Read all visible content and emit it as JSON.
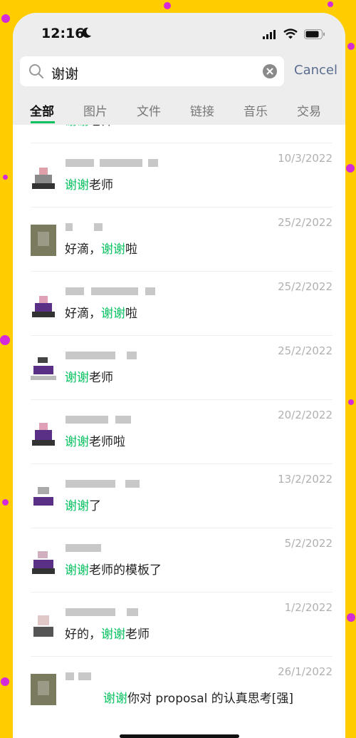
{
  "status_bar": {
    "time": "12:16"
  },
  "search": {
    "query": "谢谢",
    "cancel_label": "Cancel"
  },
  "tabs": [
    {
      "label": "全部",
      "active": true
    },
    {
      "label": "图片"
    },
    {
      "label": "文件"
    },
    {
      "label": "链接"
    },
    {
      "label": "音乐"
    },
    {
      "label": "交易"
    }
  ],
  "results": [
    {
      "date": "",
      "pre": "",
      "highlight": "谢谢",
      "post": "老师"
    },
    {
      "date": "10/3/2022",
      "pre": "",
      "highlight": "谢谢",
      "post": "老师"
    },
    {
      "date": "25/2/2022",
      "pre": "好滴，",
      "highlight": "谢谢",
      "post": "啦"
    },
    {
      "date": "25/2/2022",
      "pre": "好滴，",
      "highlight": "谢谢",
      "post": "啦"
    },
    {
      "date": "25/2/2022",
      "pre": "",
      "highlight": "谢谢",
      "post": "老师"
    },
    {
      "date": "20/2/2022",
      "pre": "",
      "highlight": "谢谢",
      "post": "老师啦"
    },
    {
      "date": "13/2/2022",
      "pre": "",
      "highlight": "谢谢",
      "post": "了"
    },
    {
      "date": "5/2/2022",
      "pre": "",
      "highlight": "谢谢",
      "post": "老师的模板了"
    },
    {
      "date": "1/2/2022",
      "pre": "好的，",
      "highlight": "谢谢",
      "post": "老师"
    },
    {
      "date": "26/1/2022",
      "pre": "",
      "highlight": "谢谢",
      "post": "你对 proposal 的认真思考[强]"
    }
  ],
  "colors": {
    "accent": "#07c160",
    "link": "#5a6d8f",
    "frame": "#ffcc00"
  },
  "icons": [
    "moon-icon",
    "signal-icon",
    "wifi-icon",
    "battery-icon",
    "search-icon",
    "clear-icon"
  ]
}
